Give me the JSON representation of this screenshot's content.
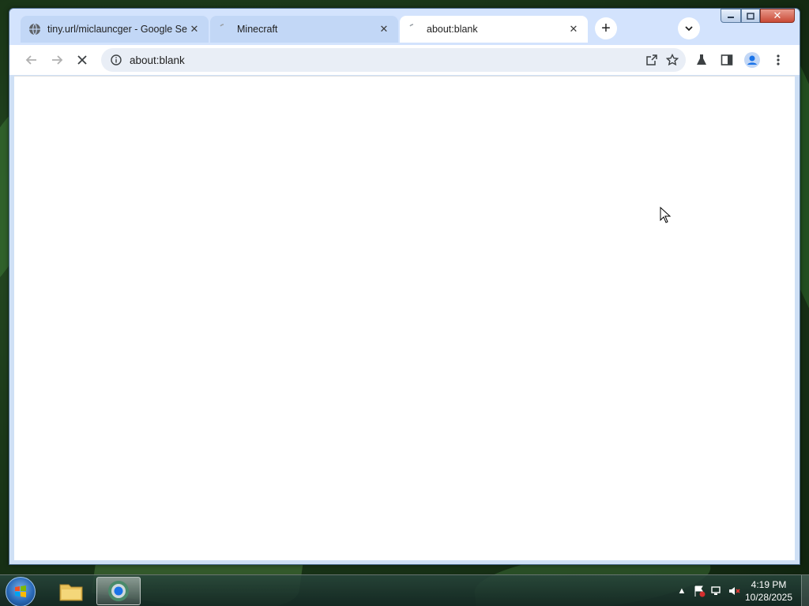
{
  "browser": {
    "tabs": [
      {
        "title": "tiny.url/miclauncger - Google Se",
        "active": false,
        "favicon": "globe-icon"
      },
      {
        "title": "Minecraft",
        "active": false,
        "favicon": "loading-icon"
      },
      {
        "title": "about:blank",
        "active": true,
        "favicon": "loading-icon"
      }
    ],
    "new_tab_label": "+",
    "address": "about:blank"
  },
  "taskbar": {
    "time": "4:19 PM",
    "date": "10/28/2025",
    "items": [
      "start-orb",
      "file-explorer",
      "chrome"
    ]
  },
  "colors": {
    "tabstrip": "#d3e3fd",
    "omnibox": "#e9eef6",
    "profile": "#1a73e8"
  }
}
